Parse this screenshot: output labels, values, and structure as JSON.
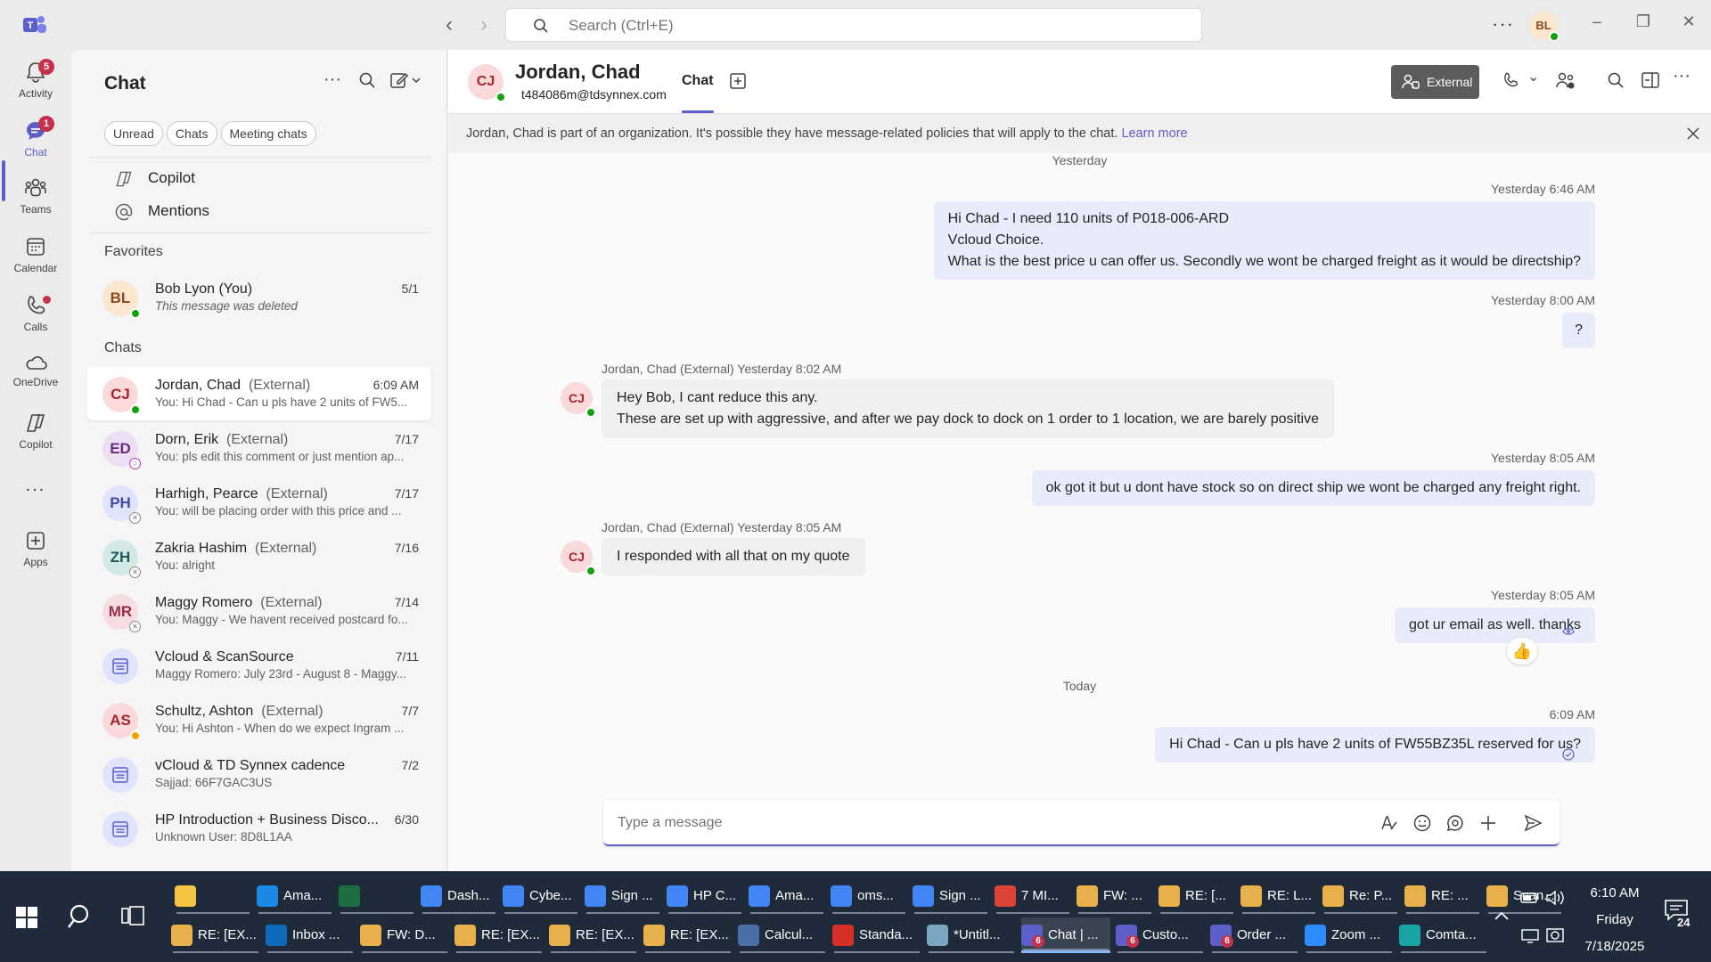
{
  "app": {
    "title": "Microsoft Teams"
  },
  "search": {
    "placeholder": "Search (Ctrl+E)"
  },
  "me": {
    "initials": "BL"
  },
  "rail": {
    "items": [
      {
        "label": "Activity",
        "badge": "5"
      },
      {
        "label": "Chat",
        "badge": "1"
      },
      {
        "label": "Teams"
      },
      {
        "label": "Calendar"
      },
      {
        "label": "Calls"
      },
      {
        "label": "OneDrive"
      },
      {
        "label": "Copilot"
      },
      {
        "label": "Apps"
      }
    ],
    "more": "..."
  },
  "list": {
    "title": "Chat",
    "filters": [
      "Unread",
      "Chats",
      "Meeting chats"
    ],
    "shortcuts": [
      {
        "label": "Copilot"
      },
      {
        "label": "Mentions"
      }
    ],
    "favorites_heading": "Favorites",
    "favorite": {
      "initials": "BL",
      "name": "Bob Lyon (You)",
      "time": "5/1",
      "preview": "This message was deleted"
    },
    "chats_heading": "Chats",
    "chats": [
      {
        "initials": "CJ",
        "name": "Jordan, Chad",
        "ext": "(External)",
        "time": "6:09 AM",
        "preview": "You: Hi Chad -  Can u pls have 2 units of FW5..."
      },
      {
        "initials": "ED",
        "name": "Dorn, Erik",
        "ext": "(External)",
        "time": "7/17",
        "preview": "You: pls edit this comment or just mention ap..."
      },
      {
        "initials": "PH",
        "name": "Harhigh, Pearce",
        "ext": "(External)",
        "time": "7/17",
        "preview": "You: will be placing order with this price and ..."
      },
      {
        "initials": "ZH",
        "name": "Zakria Hashim",
        "ext": "(External)",
        "time": "7/16",
        "preview": "You: alright"
      },
      {
        "initials": "MR",
        "name": "Maggy Romero",
        "ext": "(External)",
        "time": "7/14",
        "preview": "You: Maggy - We havent received postcard fo..."
      },
      {
        "initials": "",
        "name": "Vcloud & ScanSource",
        "ext": "",
        "time": "7/11",
        "preview": "Maggy Romero: July 23rd - August 8 - Maggy..."
      },
      {
        "initials": "AS",
        "name": "Schultz, Ashton",
        "ext": "(External)",
        "time": "7/7",
        "preview": "You: Hi Ashton -  When do we expect Ingram ..."
      },
      {
        "initials": "",
        "name": "vCloud & TD Synnex cadence",
        "ext": "",
        "time": "7/2",
        "preview": "Sajjad: 66F7GAC3US"
      },
      {
        "initials": "",
        "name": "HP Introduction + Business Disco...",
        "ext": "",
        "time": "6/30",
        "preview": "Unknown User: 8D8L1AA"
      }
    ]
  },
  "conversation": {
    "initials": "CJ",
    "name": "Jordan, Chad",
    "email": "t484086m@tdsynnex.com",
    "tab": "Chat",
    "external_label": "External",
    "notice": "Jordan, Chad is part of an organization. It's possible they have message-related policies that will apply to the chat.",
    "notice_link": "Learn more",
    "day_yesterday": "Yesterday",
    "day_today": "Today",
    "messages": [
      {
        "meta": "Yesterday 6:46 AM",
        "lines": [
          "Hi Chad -  I need 110 units of P018-006-ARD",
          "Vcloud Choice.",
          "What is the best price u can offer us. Secondly we wont be charged freight as it would be directship?"
        ]
      },
      {
        "meta": "Yesterday 8:00 AM",
        "lines": [
          "?"
        ]
      },
      {
        "meta": "Jordan, Chad (External)  Yesterday 8:02 AM",
        "lines": [
          "Hey Bob, I cant reduce this any.",
          "These are set up with aggressive, and after we pay dock to dock on 1 order to 1 location, we are barely positive"
        ]
      },
      {
        "meta": "Yesterday 8:05 AM",
        "lines": [
          "ok got it but u dont have stock so on direct ship we wont be charged any freight right."
        ]
      },
      {
        "meta": "Jordan, Chad (External)  Yesterday 8:05 AM",
        "lines": [
          "I responded with all that on my quote"
        ]
      },
      {
        "meta": "Yesterday 8:05 AM",
        "lines": [
          "got ur email as well. thanks"
        ],
        "reaction": "👍"
      },
      {
        "meta": "6:09 AM",
        "lines": [
          "Hi Chad -  Can u pls have 2 units of FW55BZ35L reserved for us?"
        ]
      }
    ],
    "compose_placeholder": "Type a message"
  },
  "taskbar": {
    "row1": [
      {
        "label": "",
        "color": "#f4c542"
      },
      {
        "label": "Ama...",
        "color": "#1e88e5"
      },
      {
        "label": "",
        "color": "#1d6f42"
      },
      {
        "label": "Dash...",
        "color": "#4285f4"
      },
      {
        "label": "Cybe...",
        "color": "#4285f4"
      },
      {
        "label": "Sign ...",
        "color": "#4285f4"
      },
      {
        "label": "HP C...",
        "color": "#4285f4"
      },
      {
        "label": "Ama...",
        "color": "#4285f4"
      },
      {
        "label": "oms...",
        "color": "#4285f4"
      },
      {
        "label": "Sign ...",
        "color": "#4285f4"
      },
      {
        "label": "7 MI...",
        "color": "#db4437"
      },
      {
        "label": "FW: ...",
        "color": "#e8b04a"
      },
      {
        "label": "RE: [...",
        "color": "#e8b04a"
      },
      {
        "label": "RE: L...",
        "color": "#e8b04a"
      },
      {
        "label": "Re: P...",
        "color": "#e8b04a"
      },
      {
        "label": "RE: ...",
        "color": "#e8b04a"
      },
      {
        "label": "Scan...",
        "color": "#e8b04a"
      }
    ],
    "row2": [
      {
        "label": "RE: [EX...",
        "color": "#e8b04a"
      },
      {
        "label": "Inbox ...",
        "color": "#0f6cbd"
      },
      {
        "label": "FW: D...",
        "color": "#e8b04a"
      },
      {
        "label": "RE: [EX...",
        "color": "#e8b04a"
      },
      {
        "label": "RE: [EX...",
        "color": "#e8b04a"
      },
      {
        "label": "RE: [EX...",
        "color": "#e8b04a"
      },
      {
        "label": "Calcul...",
        "color": "#4a6fa5"
      },
      {
        "label": "Standa...",
        "color": "#d93025"
      },
      {
        "label": "*Untitl...",
        "color": "#7aa6c2"
      },
      {
        "label": "Chat | ...",
        "color": "#5b5fc7",
        "badge": "6"
      },
      {
        "label": "Custo...",
        "color": "#5b5fc7",
        "badge": "6"
      },
      {
        "label": "Order ...",
        "color": "#5b5fc7",
        "badge": "6"
      },
      {
        "label": "Zoom ...",
        "color": "#2d8cff"
      },
      {
        "label": "Comta...",
        "color": "#1aa5a5"
      }
    ],
    "time": "6:10 AM",
    "day": "Friday",
    "date": "7/18/2025",
    "notifications": "24"
  }
}
